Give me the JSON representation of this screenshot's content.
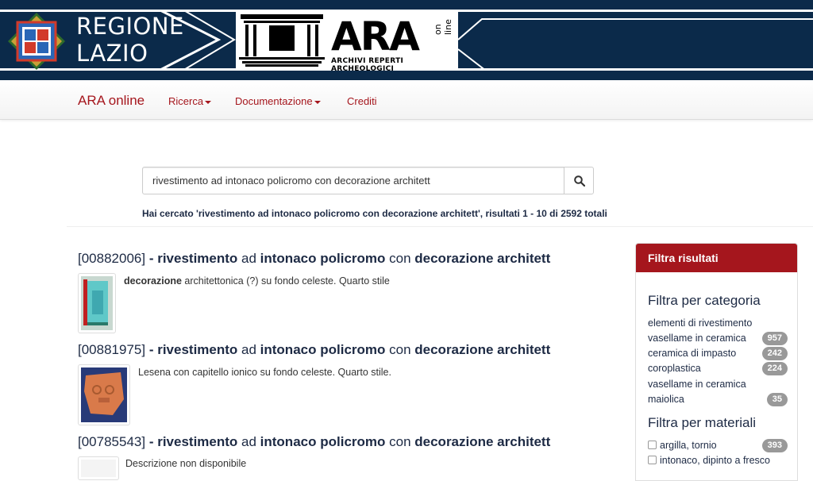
{
  "header": {
    "region_line1": "REGIONE",
    "region_line2": "LAZIO",
    "logo_big": "ARA",
    "logo_online": "on line",
    "logo_sub": "ARCHIVI REPERTI ARCHEOLOGICI",
    "colors": {
      "banner": "#0b2a4a",
      "accent": "#a5161d"
    }
  },
  "nav": {
    "brand": "ARA online",
    "items": [
      {
        "label": "Ricerca",
        "has_dropdown": true
      },
      {
        "label": "Documentazione",
        "has_dropdown": true
      },
      {
        "label": "Crediti",
        "has_dropdown": false
      }
    ]
  },
  "search": {
    "value": "rivestimento ad intonaco policromo con decorazione architett",
    "icon": "search-icon",
    "summary_prefix": "Hai cercato '",
    "summary_query": "rivestimento ad intonaco policromo con decorazione architett",
    "summary_mid": "', risultati ",
    "summary_range": "1 - 10",
    "summary_di": " di ",
    "summary_total": "2592",
    "summary_suffix": " totali"
  },
  "results": [
    {
      "code": "[00882006]",
      "sep": " - ",
      "w1": "rivestimento",
      "t1": " ad ",
      "w2": "intonaco",
      "t2": " ",
      "w3": "policromo",
      "t3": " con ",
      "w4": "decorazione architett",
      "desc_bold": "decorazione",
      "desc_rest": " architettonica (?) su fondo celeste. Quarto stile"
    },
    {
      "code": "[00881975]",
      "sep": " - ",
      "w1": "rivestimento",
      "t1": " ad ",
      "w2": "intonaco",
      "t2": " ",
      "w3": "policromo",
      "t3": " con ",
      "w4": "decorazione architett",
      "desc_bold": "",
      "desc_rest": "Lesena con capitello ionico su fondo celeste. Quarto stile."
    },
    {
      "code": "[00785543]",
      "sep": " - ",
      "w1": "rivestimento",
      "t1": " ad ",
      "w2": "intonaco",
      "t2": " ",
      "w3": "policromo",
      "t3": " con ",
      "w4": "decorazione architett",
      "desc_bold": "",
      "desc_rest": "Descrizione non disponibile"
    }
  ],
  "filters": {
    "title": "Filtra risultati",
    "category_heading": "Filtra per categoria",
    "categories": [
      {
        "label": "elementi di rivestimento",
        "count": ""
      },
      {
        "label": "vasellame in ceramica",
        "count": "957"
      },
      {
        "label": "ceramica di impasto",
        "count": "242"
      },
      {
        "label": "coroplastica",
        "count": "224"
      },
      {
        "label": "vasellame in ceramica",
        "count": ""
      },
      {
        "label": "maiolica",
        "count": "35"
      }
    ],
    "material_heading": "Filtra per materiali",
    "materials": [
      {
        "label": "argilla, tornio",
        "count": "393"
      },
      {
        "label": "intonaco, dipinto a fresco",
        "count": ""
      }
    ]
  }
}
